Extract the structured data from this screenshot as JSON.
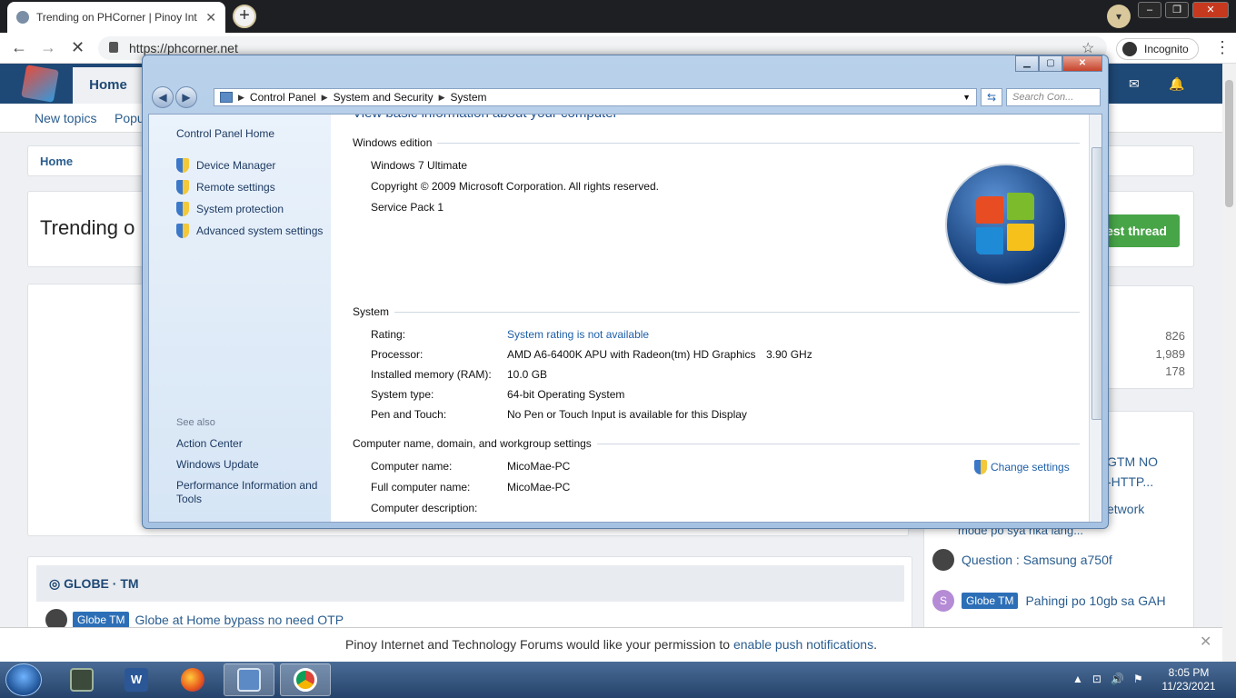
{
  "browser": {
    "tab_title": "Trending on PHCorner | Pinoy Int",
    "url": "https://phcorner.net",
    "incognito_label": "Incognito"
  },
  "forum": {
    "nav_home": "Home",
    "subnav": [
      "New topics",
      "Popu"
    ],
    "breadcrumb": "Home",
    "page_title": "Trending o",
    "post_button": "est thread",
    "stats": [
      "826",
      "1,989",
      "178"
    ],
    "side_items": [
      "GTM NO",
      "-HTTP...",
      "etwork",
      "mode po sya nka lang..."
    ],
    "questions": [
      {
        "text": "Question : Samsung a750f",
        "avatar": ""
      },
      {
        "badge": "Globe TM",
        "text": "Pahingi po 10gb sa GAH",
        "avatar": "S"
      }
    ],
    "section_title": "GLOBE · TM",
    "section_row": {
      "badge": "Globe TM",
      "text": "Globe at Home bypass no need OTP"
    },
    "push_text": "Pinoy Internet and Technology Forums would like your permission to ",
    "push_link": "enable push notifications",
    "push_end": "."
  },
  "window": {
    "address": [
      "Control Panel",
      "System and Security",
      "System"
    ],
    "search_placeholder": "Search Con...",
    "left_links": {
      "home": "Control Panel Home",
      "items": [
        "Device Manager",
        "Remote settings",
        "System protection",
        "Advanced system settings"
      ],
      "see_also": "See also",
      "see_also_items": [
        "Action Center",
        "Windows Update",
        "Performance Information and Tools"
      ]
    },
    "view_title": "View basic information about your computer",
    "edition": {
      "header": "Windows edition",
      "name": "Windows 7 Ultimate",
      "copyright": "Copyright © 2009 Microsoft Corporation.  All rights reserved.",
      "sp": "Service Pack 1"
    },
    "system": {
      "header": "System",
      "rows": [
        {
          "label": "Rating:",
          "value": "System rating is not available",
          "link": true
        },
        {
          "label": "Processor:",
          "value": "AMD A6-6400K APU with Radeon(tm) HD Graphics",
          "extra": "3.90 GHz"
        },
        {
          "label": "Installed memory (RAM):",
          "value": "10.0 GB"
        },
        {
          "label": "System type:",
          "value": "64-bit Operating System"
        },
        {
          "label": "Pen and Touch:",
          "value": "No Pen or Touch Input is available for this Display"
        }
      ]
    },
    "computer": {
      "header": "Computer name, domain, and workgroup settings",
      "change": "Change settings",
      "rows": [
        {
          "label": "Computer name:",
          "value": "MicoMae-PC"
        },
        {
          "label": "Full computer name:",
          "value": "MicoMae-PC"
        },
        {
          "label": "Computer description:",
          "value": ""
        }
      ]
    }
  },
  "taskbar": {
    "time": "8:05 PM",
    "date": "11/23/2021",
    "apps": [
      "task-manager",
      "word",
      "firefox",
      "control-panel",
      "chrome"
    ]
  }
}
